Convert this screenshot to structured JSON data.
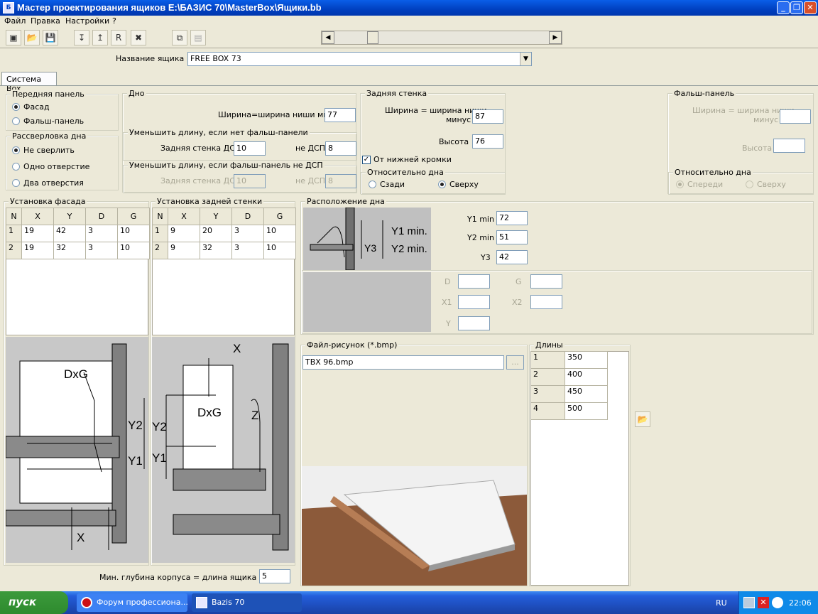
{
  "window": {
    "title": "Мастер проектирования ящиков  E:\\БАЗИС 70\\MasterBox\\Ящики.bb",
    "app_icon": "Б"
  },
  "menu": [
    "Файл",
    "Правка",
    "Настройки",
    "?"
  ],
  "box_name": {
    "label": "Название ящика",
    "value": "FREE  BOX 73"
  },
  "tab": "Система Box",
  "front_panel": {
    "title": "Передняя панель",
    "options": [
      "Фасад",
      "Фальш-панель"
    ],
    "selected": 0
  },
  "drilling": {
    "title": "Рассверловка дна",
    "options": [
      "Не сверлить",
      "Одно отверстие",
      "Два отверстия"
    ],
    "selected": 0
  },
  "bottom": {
    "title": "Дно",
    "width_label": "Ширина=ширина ниши минус",
    "width_value": "77",
    "sub1": {
      "title": "Уменьшить длину, если нет фальш-панели",
      "back_dsp_label": "Задняя стенка ДСП",
      "back_dsp_value": "10",
      "not_dsp_label": "не ДСП",
      "not_dsp_value": "8"
    },
    "sub2": {
      "title": "Уменьшить длину, если фальш-панель не ДСП",
      "back_dsp_label": "Задняя стенка ДСП",
      "back_dsp_value": "10",
      "not_dsp_label": "не ДСП",
      "not_dsp_value": "8"
    }
  },
  "back_wall": {
    "title": "Задняя стенка",
    "width_label_1": "Ширина = ширина ниши",
    "width_label_2": "минус",
    "width_value": "87",
    "height_label": "Высота",
    "height_value": "76",
    "from_bottom_label": "От нижней кромки",
    "from_bottom_checked": true,
    "relative_title": "Относительно дна",
    "options": [
      "Сзади",
      "Сверху"
    ],
    "selected": 1
  },
  "false_panel": {
    "title": "Фальш-панель",
    "width_label_1": "Ширина = ширина ниши",
    "width_label_2": "минус",
    "width_value": "",
    "height_label": "Высота",
    "height_value": "",
    "relative_title": "Относительно дна",
    "options": [
      "Спереди",
      "Сверху"
    ],
    "selected": 0
  },
  "facade_setup": {
    "title": "Установка фасада",
    "columns": [
      "N",
      "X",
      "Y",
      "D",
      "G"
    ],
    "rows": [
      [
        "1",
        "19",
        "42",
        "3",
        "10"
      ],
      [
        "2",
        "19",
        "32",
        "3",
        "10"
      ]
    ]
  },
  "back_setup": {
    "title": "Установка задней стенки",
    "columns": [
      "N",
      "X",
      "Y",
      "D",
      "G"
    ],
    "rows": [
      [
        "1",
        "9",
        "20",
        "3",
        "10"
      ],
      [
        "2",
        "9",
        "32",
        "3",
        "10"
      ]
    ]
  },
  "diagram1": {
    "labels": [
      "DxG",
      "Y2",
      "Y1",
      "X"
    ]
  },
  "diagram2": {
    "labels": [
      "X",
      "DxG",
      "Y2",
      "Y1",
      "Z"
    ]
  },
  "bottom_position": {
    "title": "Расположение дна",
    "diagram_labels": [
      "Y1 min.",
      "Y2 min.",
      "Y3"
    ],
    "y1_label": "Y1 min",
    "y1_value": "72",
    "y2_label": "Y2 min",
    "y2_value": "51",
    "y3_label": "Y3",
    "y3_value": "42",
    "extra": {
      "d_label": "D",
      "g_label": "G",
      "x1_label": "X1",
      "x2_label": "X2",
      "y_label": "Y"
    }
  },
  "picture_file": {
    "title": "Файл-рисунок (*.bmp)",
    "value": "TBX 96.bmp",
    "browse": "..."
  },
  "lengths": {
    "title": "Длины",
    "rows": [
      [
        "1",
        "350"
      ],
      [
        "2",
        "400"
      ],
      [
        "3",
        "450"
      ],
      [
        "4",
        "500"
      ]
    ]
  },
  "min_depth": {
    "label": "Мин. глубина корпуса = длина ящика плюс",
    "value": "5"
  },
  "taskbar": {
    "start": "пуск",
    "tasks": [
      {
        "label": "Форум профессиона...",
        "icon": "opera-icon"
      },
      {
        "label": "Bazis 70",
        "icon": "bazis-icon"
      }
    ],
    "lang": "RU",
    "time": "22:06"
  },
  "colors": {
    "titlebar": "#0040c0",
    "taskbar": "#245edb",
    "start": "#2e8b2e",
    "panel_bg": "#ece9d8",
    "diagram_bg": "#c0c0c0"
  }
}
